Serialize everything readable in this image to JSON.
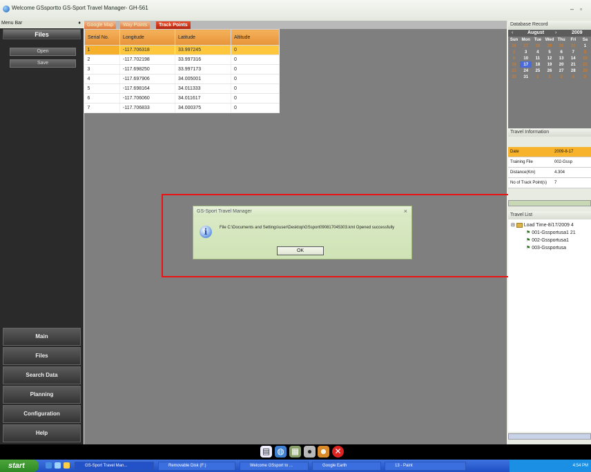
{
  "window": {
    "title": "Welcome GSsportto GS-Sport Travel Manager- GH-561",
    "min_glyph": "–",
    "max_glyph": "▫"
  },
  "menubar": {
    "label": "Menu Bar",
    "pin": "♦"
  },
  "sidebar": {
    "header": "Files",
    "buttons": [
      "Open",
      "Save"
    ],
    "nav": [
      "Main",
      "Files",
      "Search Data",
      "Planning",
      "Configuration",
      "Help"
    ]
  },
  "tabs": [
    {
      "label": "Google Map",
      "active": false
    },
    {
      "label": "Way Points",
      "active": false
    },
    {
      "label": "Track Points",
      "active": true
    }
  ],
  "grid": {
    "headers": [
      "Serial No.",
      "Longitude",
      "Latitude",
      "Altitude"
    ],
    "rows": [
      [
        "1",
        "-117.706318",
        "33.997245",
        "0"
      ],
      [
        "2",
        "-117.702198",
        "33.997316",
        "0"
      ],
      [
        "3",
        "-117.698250",
        "33.997173",
        "0"
      ],
      [
        "4",
        "-117.697906",
        "34.005001",
        "0"
      ],
      [
        "5",
        "-117.698164",
        "34.011333",
        "0"
      ],
      [
        "6",
        "-117.706060",
        "34.011617",
        "0"
      ],
      [
        "7",
        "-117.706833",
        "34.000375",
        "0"
      ]
    ]
  },
  "dialog": {
    "title": "GS-Sport Travel Manager",
    "close": "×",
    "icon": "info-icon",
    "message": "File C:\\Documents and Settings\\user\\Desktop\\GSsport090817045303.kml Opened successfully",
    "ok_label": "OK"
  },
  "database": {
    "header": "Database Record",
    "month": "August",
    "year": "2009",
    "prev": "‹",
    "next": "›",
    "days": [
      "Sun",
      "Mon",
      "Tue",
      "Wed",
      "Thu",
      "Fri",
      "Sa"
    ],
    "weeks": [
      [
        "26",
        "27",
        "28",
        "29",
        "30",
        "31",
        "1"
      ],
      [
        "2",
        "3",
        "4",
        "5",
        "6",
        "7",
        "8"
      ],
      [
        "9",
        "10",
        "11",
        "12",
        "13",
        "14",
        "15"
      ],
      [
        "16",
        "17",
        "18",
        "19",
        "20",
        "21",
        "22"
      ],
      [
        "23",
        "24",
        "25",
        "26",
        "27",
        "28",
        "29"
      ],
      [
        "30",
        "31",
        "1",
        "2",
        "3",
        "4",
        "5"
      ]
    ]
  },
  "travel_info": {
    "header": "Travel Information",
    "rows": [
      {
        "label": "Date",
        "value": "2009-8-17"
      },
      {
        "label": "Training File",
        "value": "002-Gssp"
      },
      {
        "label": "Distance(Km)",
        "value": "4.304"
      },
      {
        "label": "No of Track Point(s)",
        "value": "7"
      }
    ]
  },
  "travel_list": {
    "header": "Travel List",
    "root": "Load Time-8/17/2009 4",
    "items": [
      "001-Gssportusa1 21",
      "002-Gssportusa1",
      "003-Gssportusa"
    ]
  },
  "toolbar_icons": [
    "new-file-icon",
    "globe-icon",
    "map-icon",
    "pin-icon",
    "people-icon",
    "exit-icon"
  ],
  "taskbar": {
    "start": "start",
    "tasks": [
      "GS-Sport Travel Man...",
      "Removable Disk (F:)",
      "Welcome GSsport to ...",
      "Google Earth",
      "13 - Paint"
    ],
    "clock": "4:54 PM"
  },
  "colors": {
    "accent_orange": "#f7b32b",
    "tab_active": "#c9301a",
    "highlight": "#e11111"
  }
}
